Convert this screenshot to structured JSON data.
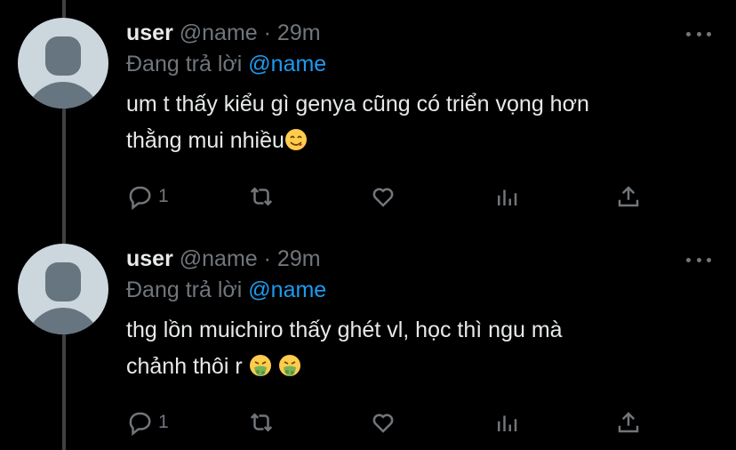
{
  "tweets": [
    {
      "user": "user",
      "handle": "@name",
      "dot": "·",
      "time": "29m",
      "reply_prefix": "Đang trả lời",
      "reply_to": "@name",
      "line1": "um t thấy kiểu gì genya cũng có triển vọng hơn",
      "line2": "thằng mui nhiều",
      "emoji": [
        "face-savoring-food"
      ],
      "reply_count": "1"
    },
    {
      "user": "user",
      "handle": "@name",
      "dot": "·",
      "time": "29m",
      "reply_prefix": "Đang trả lời",
      "reply_to": "@name",
      "line1": "thg lồn muichiro thấy ghét vl, học thì ngu mà",
      "line2": "chảnh thôi r",
      "emoji": [
        "face-vomiting",
        "face-vomiting"
      ],
      "reply_count": "1"
    }
  ],
  "icons": [
    "reply-icon",
    "retweet-icon",
    "like-icon",
    "analytics-icon",
    "share-icon",
    "more-icon"
  ],
  "colors": {
    "background": "#000000",
    "text": "#e7e9ea",
    "muted": "#71767b",
    "accent": "#1d9bf0",
    "thread_line": "#3e4144"
  }
}
